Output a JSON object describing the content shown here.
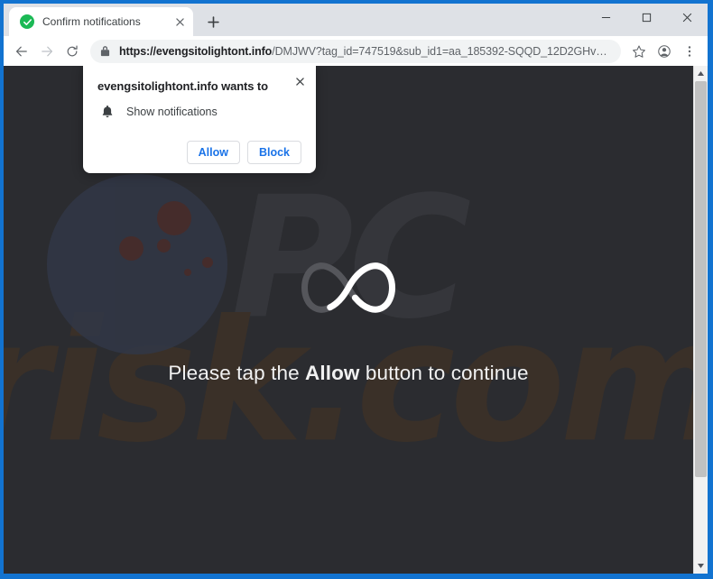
{
  "browser": {
    "tab": {
      "title": "Confirm notifications",
      "favicon": "check-circle-icon",
      "close": "×"
    },
    "new_tab_label": "+",
    "window_controls": {
      "minimize": "minimize-icon",
      "maximize": "maximize-icon",
      "close": "close-icon"
    },
    "toolbar": {
      "back": "back-arrow-icon",
      "forward": "forward-arrow-icon",
      "reload": "reload-icon",
      "lock": "lock-icon",
      "url_domain": "https://evengsitolightont.info",
      "url_path": "/DMJWV?tag_id=747519&sub_id1=aa_185392-SQQD_12D2GHvmSm1I3nW&sub_id2…",
      "bookmark": "star-icon",
      "profile": "account-avatar-icon",
      "menu": "three-dot-menu-icon"
    }
  },
  "permission_dialog": {
    "title": "evengsitolightont.info wants to",
    "option_icon": "bell-icon",
    "option_label": "Show notifications",
    "allow_label": "Allow",
    "block_label": "Block",
    "close_label": "×"
  },
  "page": {
    "watermark_line1": "PC",
    "watermark_line2": "risk.com",
    "spinner": "infinity-loading-spinner",
    "headline_pre": "Please tap the ",
    "headline_bold": "Allow",
    "headline_post": " button to continue"
  },
  "colors": {
    "window_frame": "#1273d0",
    "page_background": "#2b2c30",
    "accent_blue": "#1a73e8",
    "favicon_green": "#1bb955",
    "tabstrip": "#dee1e6"
  },
  "scrollbar": {
    "up": "scroll-up-arrow-icon",
    "down": "scroll-down-arrow-icon"
  }
}
